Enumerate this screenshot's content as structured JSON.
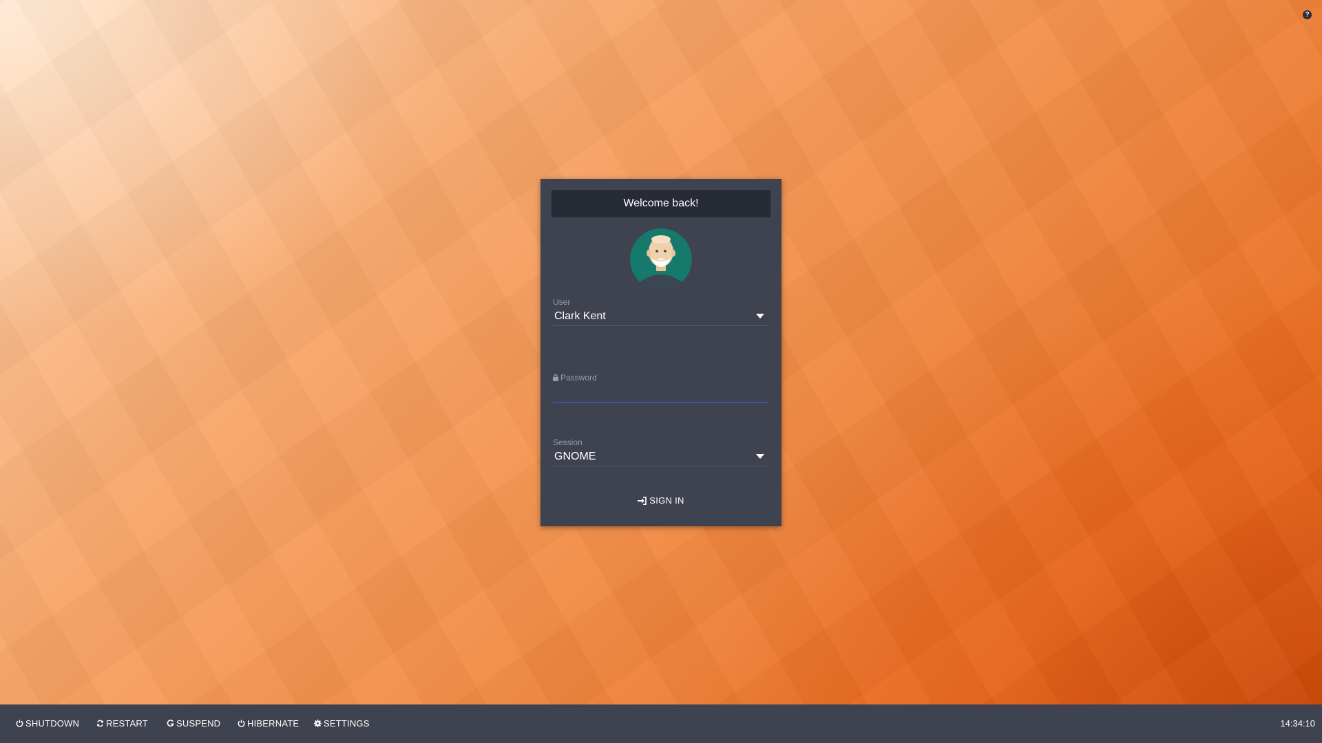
{
  "header": {
    "help_symbol": "?"
  },
  "login": {
    "title": "Welcome back!",
    "user_label": "User",
    "user_value": "Clark Kent",
    "password_label": "Password",
    "password_value": "",
    "session_label": "Session",
    "session_value": "GNOME",
    "signin_label": "SIGN IN"
  },
  "bottom_bar": {
    "shutdown_label": "SHUTDOWN",
    "restart_label": "RESTART",
    "suspend_label": "SUSPEND",
    "hibernate_label": "HIBERNATE",
    "settings_label": "SETTINGS",
    "clock": "14:34:10"
  },
  "icons": {
    "help": "question-circle-icon",
    "avatar": "user-avatar",
    "lock": "lock-icon",
    "signin": "sign-in-icon",
    "shutdown": "power-icon",
    "restart": "refresh-icon",
    "suspend": "suspend-icon",
    "hibernate": "power-icon",
    "settings": "gear-icon"
  },
  "colors": {
    "panel": "#3f424f",
    "title_bar": "#262b35",
    "accent": "#3f51b5",
    "avatar_bg": "#157a6c"
  }
}
